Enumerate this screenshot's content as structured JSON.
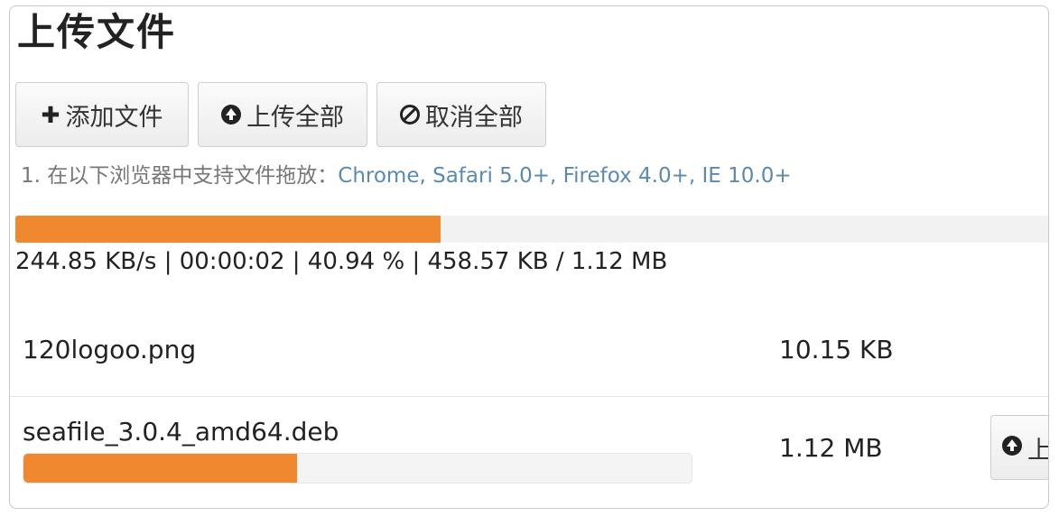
{
  "title": "上传文件",
  "toolbar": {
    "add_icon": "plus-icon",
    "add_label": "添加文件",
    "upload_icon": "circle-arrow-up-icon",
    "upload_label": "上传全部",
    "cancel_icon": "ban-icon",
    "cancel_label": "取消全部"
  },
  "note": {
    "prefix": "1.  在以下浏览器中支持文件拖放：",
    "browsers": "Chrome, Safari 5.0+, Firefox 4.0+, IE 10.0+"
  },
  "overall_progress": {
    "percent": 40.94,
    "stats": "244.85 KB/s | 00:00:02 | 40.94 % | 458.57 KB / 1.12 MB"
  },
  "files": [
    {
      "name": "120logoo.png",
      "size": "10.15 KB"
    },
    {
      "name": "seafile_3.0.4_amd64.deb",
      "size": "1.12 MB",
      "progress_percent": 40.94,
      "action_label": "上"
    }
  ],
  "colors": {
    "progress": "#f0882f",
    "note_link": "#5b8ab0"
  }
}
